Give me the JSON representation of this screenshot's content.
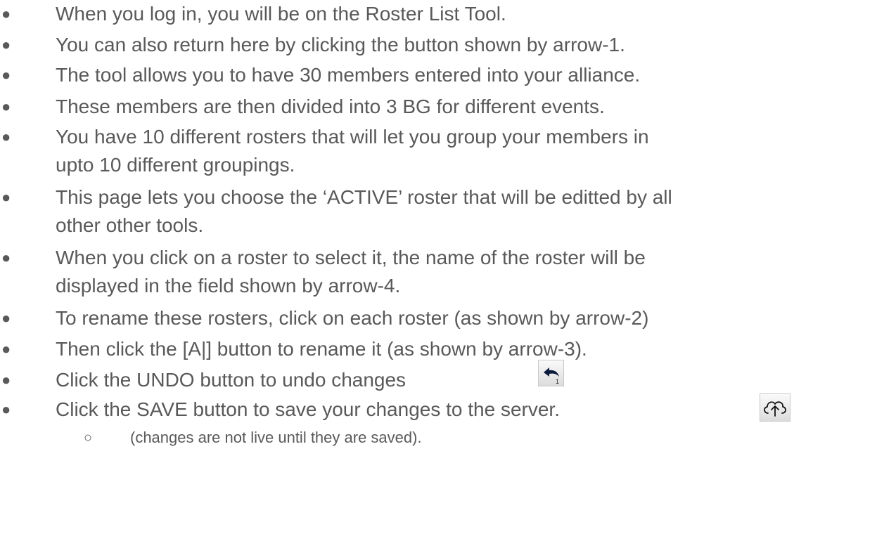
{
  "bullets": {
    "b1": "When you log in, you will be on the Roster List Tool.",
    "b2": "You can also return here by clicking the button shown by arrow-1.",
    "b3": "The tool allows you to have 30 members entered into your alliance.",
    "b4": "These members are then divided into 3 BG for different events.",
    "b5_l1": "You have 10 different rosters that will let you group your members in",
    "b5_l2": "upto 10 different groupings.",
    "b6_l1": "This page lets you choose the ‘ACTIVE’ roster that will be editted by all",
    "b6_l2": "other other tools.",
    "b7_l1": "When you click on a roster to select it, the name of the roster will be",
    "b7_l2": "displayed in the field shown by arrow-4.",
    "b8": "To rename these rosters, click on each roster (as shown by arrow-2)",
    "b9": "Then click the [A|] button to rename it (as shown by arrow-3).",
    "b10": "Click the UNDO button to undo changes",
    "b11": "Click the SAVE button to save your changes to the server.",
    "sub1": "(changes are not live until they are saved)."
  },
  "icons": {
    "undo_icon": "undo-arrow-icon",
    "undo_badge": "1",
    "save_icon": "cloud-upload-icon"
  },
  "colors": {
    "text": "#595959"
  }
}
